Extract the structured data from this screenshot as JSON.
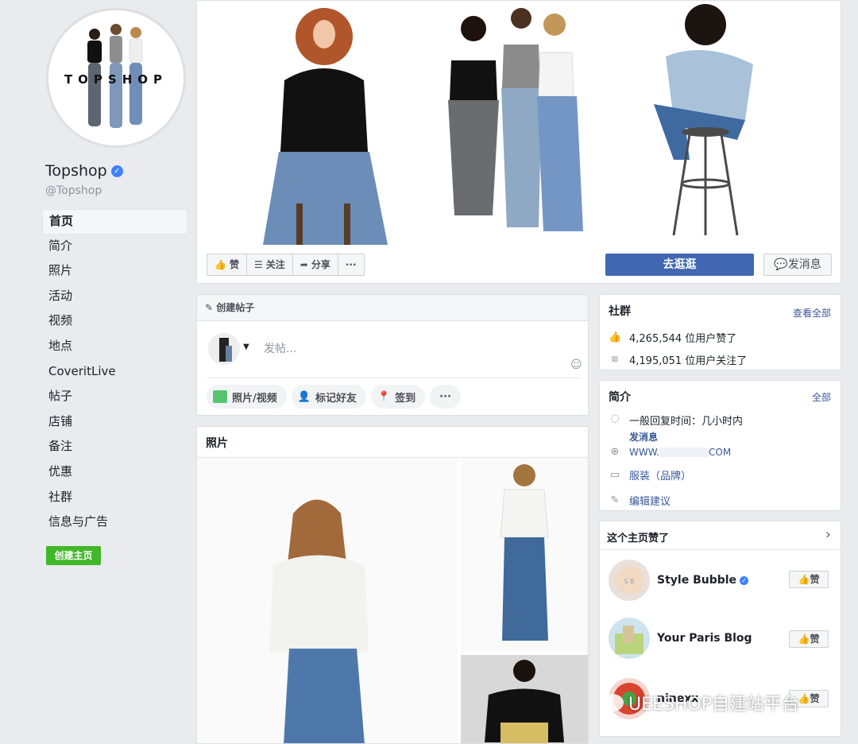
{
  "profile": {
    "logo_text": "TOPSHOP",
    "name": "Topshop",
    "handle": "@Topshop"
  },
  "nav": {
    "items": [
      {
        "label": "首页",
        "active": true
      },
      {
        "label": "简介"
      },
      {
        "label": "照片"
      },
      {
        "label": "活动"
      },
      {
        "label": "视频"
      },
      {
        "label": "地点"
      },
      {
        "label": "CoveritLive"
      },
      {
        "label": "帖子"
      },
      {
        "label": "店铺"
      },
      {
        "label": "备注"
      },
      {
        "label": "优惠"
      },
      {
        "label": "社群"
      },
      {
        "label": "信息与广告"
      }
    ],
    "create_page": "创建主页"
  },
  "cover_actions": {
    "like": "赞",
    "follow": "关注",
    "share": "分享",
    "more": "···",
    "shop": "去逛逛",
    "message": "发消息"
  },
  "create_post": {
    "header": "创建帖子",
    "placeholder": "发帖...",
    "chips": [
      "照片/视频",
      "标记好友",
      "签到",
      "···"
    ]
  },
  "photos": {
    "title": "照片"
  },
  "community": {
    "title": "社群",
    "see_all": "查看全部",
    "likes": "4,265,544 位用户赞了",
    "follows": "4,195,051 位用户关注了"
  },
  "about": {
    "title": "简介",
    "see_all": "全部",
    "response": "一般回复时间：几小时内",
    "send_message": "发消息",
    "website_prefix": "WWW.",
    "website_suffix": "COM",
    "category": "服装（品牌）",
    "suggest_edit": "编辑建议"
  },
  "liked_pages": {
    "title": "这个主页赞了",
    "items": [
      {
        "name": "Style Bubble",
        "verified": true,
        "button": "赞"
      },
      {
        "name": "Your Paris Blog",
        "verified": false,
        "button": "赞"
      },
      {
        "name": "ninexx",
        "verified": false,
        "button": "赞"
      }
    ]
  },
  "watermark": "UEESHOP自建站平台",
  "colors": {
    "brand_blue": "#4267b2",
    "link": "#385898",
    "green": "#42b72a",
    "page_bg": "#e9ebee"
  }
}
